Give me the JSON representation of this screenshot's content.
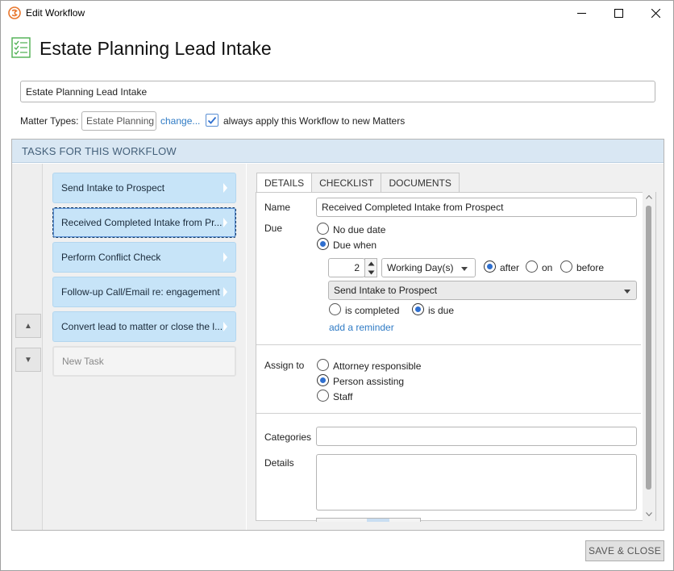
{
  "window": {
    "title": "Edit Workflow",
    "minimize_glyph": "—",
    "maximize_glyph": "☐",
    "close_glyph": "✕"
  },
  "header": {
    "title": "Estate Planning Lead Intake",
    "icon": "checklist-icon"
  },
  "workflow_name": {
    "value": "Estate Planning Lead Intake"
  },
  "matter_types": {
    "label": "Matter Types:",
    "value": "Estate Planning",
    "change_link": "change...",
    "always_apply_label": "always apply this Workflow to new Matters",
    "always_apply_checked": true
  },
  "tasks_section": {
    "header": "TASKS FOR THIS WORKFLOW",
    "move_up_glyph": "▲",
    "move_down_glyph": "▼",
    "items": [
      {
        "label": "Send Intake to Prospect",
        "selected": false
      },
      {
        "label": "Received Completed Intake from Pr...",
        "selected": true
      },
      {
        "label": "Perform Conflict Check",
        "selected": false
      },
      {
        "label": "Follow-up Call/Email re: engagement",
        "selected": false
      },
      {
        "label": "Convert lead to matter or close the l...",
        "selected": false
      }
    ],
    "new_task_label": "New Task"
  },
  "tabs": [
    {
      "label": "DETAILS",
      "active": true
    },
    {
      "label": "CHECKLIST",
      "active": false
    },
    {
      "label": "DOCUMENTS",
      "active": false
    }
  ],
  "details": {
    "name_label": "Name",
    "name_value": "Received Completed Intake from Prospect",
    "due_label": "Due",
    "due_options": {
      "no_due_date": "No due date",
      "due_when": "Due when",
      "selected": "due_when"
    },
    "offset_value": "2",
    "unit_value": "Working Day(s)",
    "relation_options": {
      "after": "after",
      "on": "on",
      "before": "before",
      "selected": "after"
    },
    "reference_task": "Send Intake to Prospect",
    "trigger_options": {
      "is_completed": "is completed",
      "is_due": "is due",
      "selected": "is_due"
    },
    "add_reminder_link": "add a reminder",
    "assign_label": "Assign to",
    "assign_options": {
      "attorney": "Attorney responsible",
      "person": "Person assisting",
      "staff": "Staff",
      "selected": "person"
    },
    "categories_label": "Categories",
    "categories_value": "",
    "details_label": "Details",
    "details_value": ""
  },
  "footer": {
    "save_close_label": "SAVE & CLOSE"
  },
  "colors": {
    "accent": "#2f7bc5",
    "task_item_bg": "#c7e4f8",
    "section_header_bg": "#d9e7f3",
    "app_icon": "#e8762c",
    "checklist_icon": "#4caf50"
  }
}
